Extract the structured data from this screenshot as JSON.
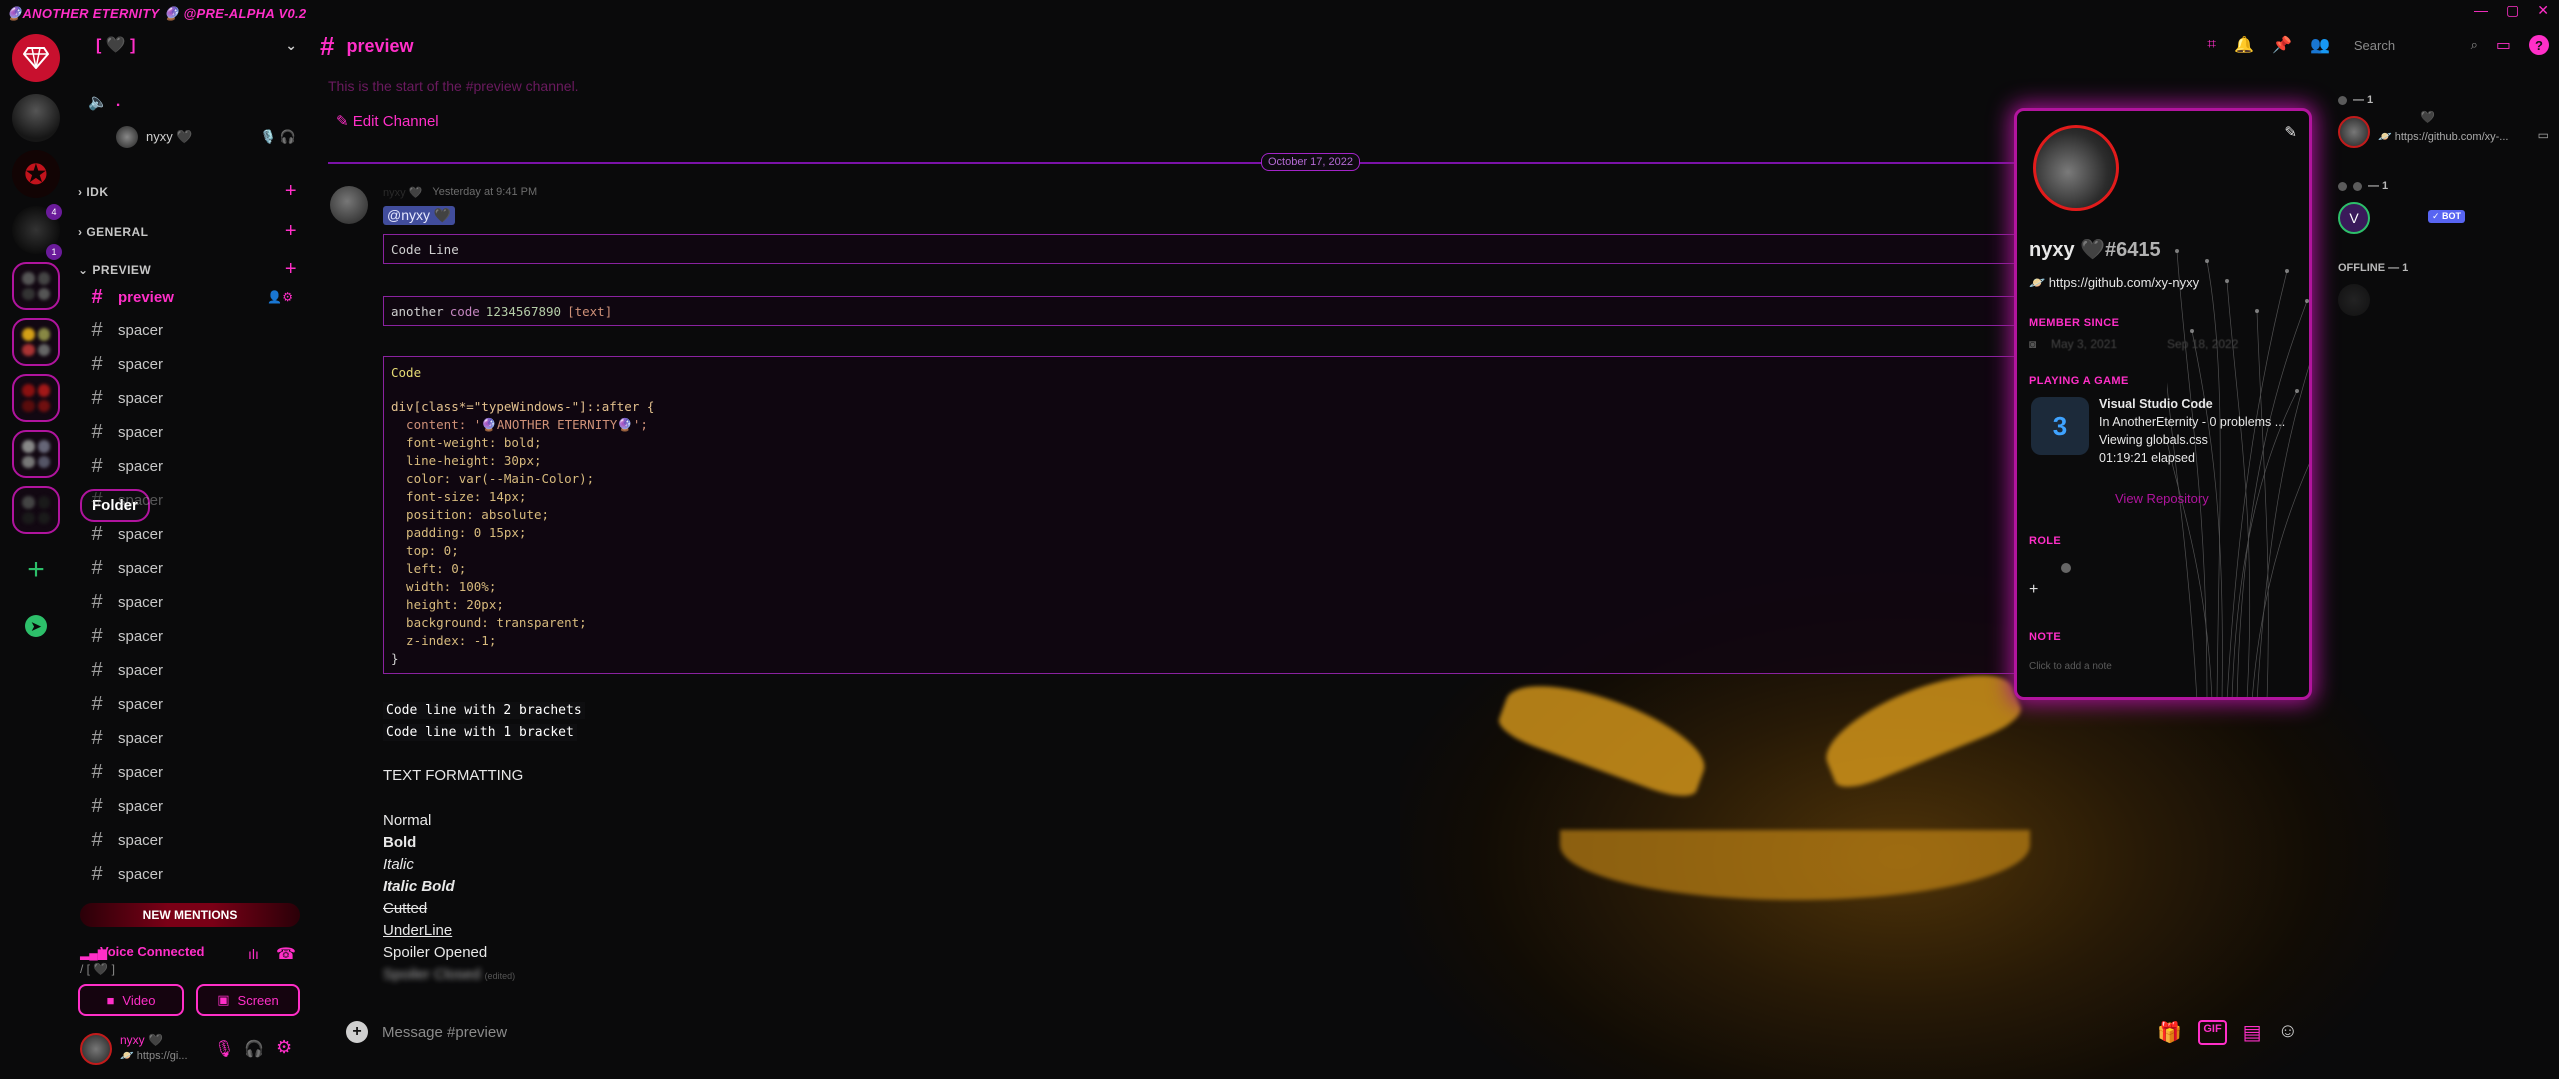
{
  "app": {
    "title": "🔮ANOTHER ETERNITY 🔮 @PRE-ALPHA V0.2",
    "win_controls": [
      "—",
      "▢",
      "✕"
    ]
  },
  "rail": {
    "tooltip": "Folder",
    "unread_badges": [
      "4",
      "1"
    ]
  },
  "guild": {
    "name": "[ 🖤 ]",
    "voice_self_label": ".",
    "voice_user": "nyxy 🖤",
    "categories": [
      "IDK",
      "GENERAL",
      "PREVIEW"
    ],
    "channels": [
      {
        "name": "preview",
        "active": true
      },
      {
        "name": "spacer"
      },
      {
        "name": "spacer"
      },
      {
        "name": "spacer"
      },
      {
        "name": "spacer"
      },
      {
        "name": "spacer"
      },
      {
        "name": "spacer"
      },
      {
        "name": "spacer"
      },
      {
        "name": "spacer"
      },
      {
        "name": "spacer"
      },
      {
        "name": "spacer"
      },
      {
        "name": "spacer"
      },
      {
        "name": "spacer"
      },
      {
        "name": "spacer"
      },
      {
        "name": "spacer"
      },
      {
        "name": "spacer"
      },
      {
        "name": "spacer"
      },
      {
        "name": "spacer"
      }
    ],
    "new_mentions": "NEW MENTIONS",
    "voice": {
      "status": "Voice Connected",
      "channel": "/ [ 🖤 ]",
      "video": "Video",
      "screen": "Screen"
    },
    "user_panel": {
      "name": "nyxy 🖤",
      "status": "🪐 https://gi..."
    }
  },
  "header": {
    "channel": "preview",
    "search_placeholder": "Search"
  },
  "chat": {
    "start": "This is the start of the #preview channel.",
    "edit_channel": "Edit Channel",
    "date": "October 17, 2022",
    "message": {
      "author": "nyxy 🖤",
      "time": "Yesterday at 9:41 PM",
      "mention": "@nyxy 🖤",
      "code_line": "Code Line",
      "inline_code": {
        "a": "another",
        "b": "code",
        "c": "1234567890",
        "d": "[text]"
      },
      "code_title": "Code",
      "code_lines": [
        "div[class*=\"typeWindows-\"]::after {",
        "  content: '🔮ANOTHER ETERNITY🔮';",
        "  font-weight: bold;",
        "  line-height: 30px;",
        "  color: var(--Main-Color);",
        "  font-size: 14px;",
        "  position: absolute;",
        "  padding: 0 15px;",
        "  top: 0;",
        "  left: 0;",
        "  width: 100%;",
        "  height: 20px;",
        "  background: transparent;",
        "  z-index: -1;",
        "}"
      ],
      "two_brackets": "Code line with 2 brachets",
      "one_bracket": "Code line with 1 bracket",
      "formatting_title": "TEXT FORMATTING",
      "normal": "Normal",
      "bold": "Bold",
      "italic": "Italic",
      "italic_bold": "Italic Bold",
      "strike": "Cutted",
      "underline": "UnderLine",
      "spoiler_open": "Spoiler Opened",
      "spoiler_closed": "Spoiler Closed",
      "edited": "(edited)"
    },
    "composer_placeholder": "Message #preview"
  },
  "profile": {
    "name": "nyxy 🖤",
    "tag": "#6415",
    "link": "🪐 https://github.com/xy-nyxy",
    "member_since_label": "MEMBER SINCE",
    "member_since_a": "May 3, 2021",
    "member_since_b": "Sep 18, 2022",
    "playing_label": "PLAYING A GAME",
    "game": {
      "title": "Visual Studio Code",
      "details": "In AnotherEternity - 0 problems ...",
      "state": "Viewing globals.css",
      "elapsed": "01:19:21 elapsed"
    },
    "view_repo": "View Repository",
    "role_label": "ROLE",
    "note_label": "NOTE",
    "note_placeholder": "Click to add a note"
  },
  "members": {
    "group1": "— 1",
    "group2": "— 1",
    "offline": "OFFLINE — 1",
    "user1_status": "🪐 https://github.com/xy-...",
    "bot_badge": "✓ BOT"
  },
  "colors": {
    "accent": "#ff2fc8",
    "popout_border": "#b2149e",
    "divider": "#7b12a8"
  }
}
